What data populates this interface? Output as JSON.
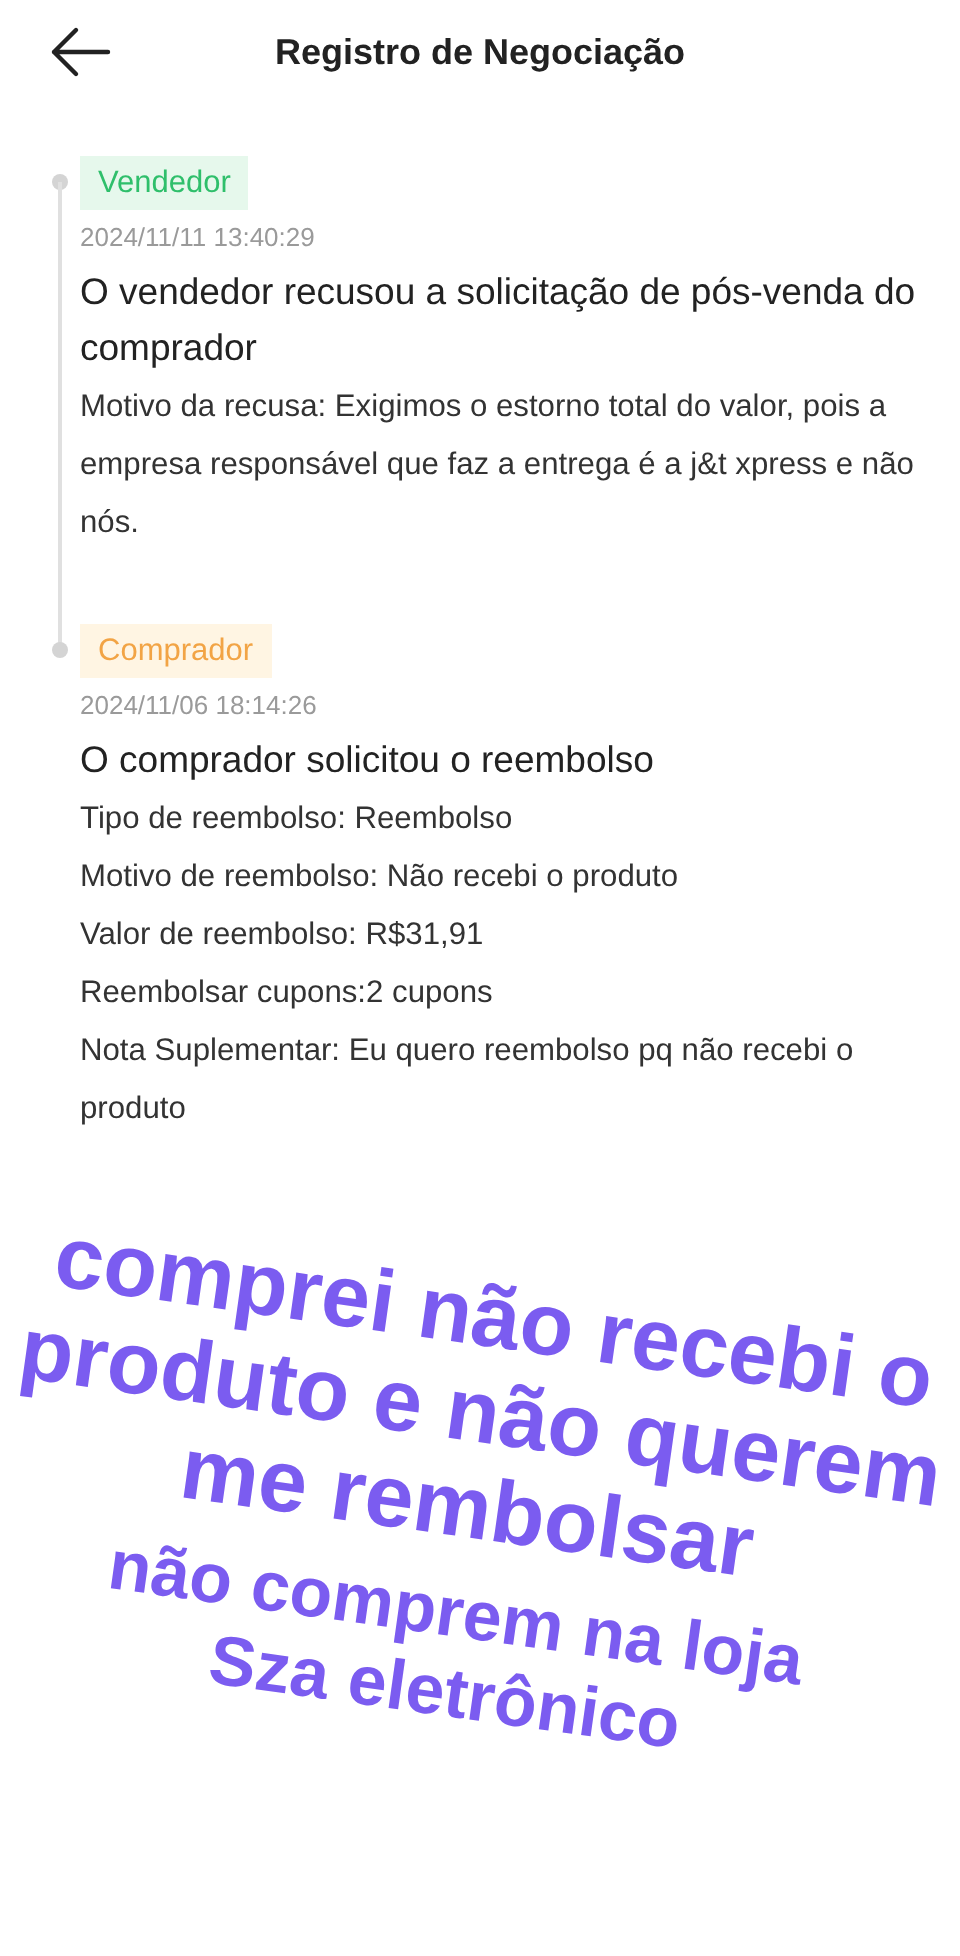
{
  "header": {
    "title": "Registro de Negociação"
  },
  "events": [
    {
      "kind": "seller",
      "tag": "Vendedor",
      "time": "2024/11/11 13:40:29",
      "heading": "O vendedor recusou a solicitação de pós-venda do comprador",
      "details": [
        "Motivo da recusa: Exigimos o estorno total do valor, pois a empresa responsável que faz a entrega é a j&t xpress e não nós."
      ]
    },
    {
      "kind": "buyer",
      "tag": "Comprador",
      "time": "2024/11/06 18:14:26",
      "heading": "O comprador solicitou o reembolso",
      "details": [
        "Tipo de reembolso: Reembolso",
        "Motivo de reembolso: Não recebi o produto",
        "Valor de reembolso: R$31,91",
        "Reembolsar cupons:2 cupons",
        "Nota Suplementar: Eu quero reembolso pq não recebi o produto"
      ]
    }
  ],
  "annotations": [
    {
      "kind": "large",
      "lines": [
        "comprei não recebi o",
        "produto e não querem",
        "me rembolsar"
      ]
    },
    {
      "kind": "small",
      "lines": [
        "não comprem na loja",
        "Sza eletrônico"
      ]
    }
  ]
}
